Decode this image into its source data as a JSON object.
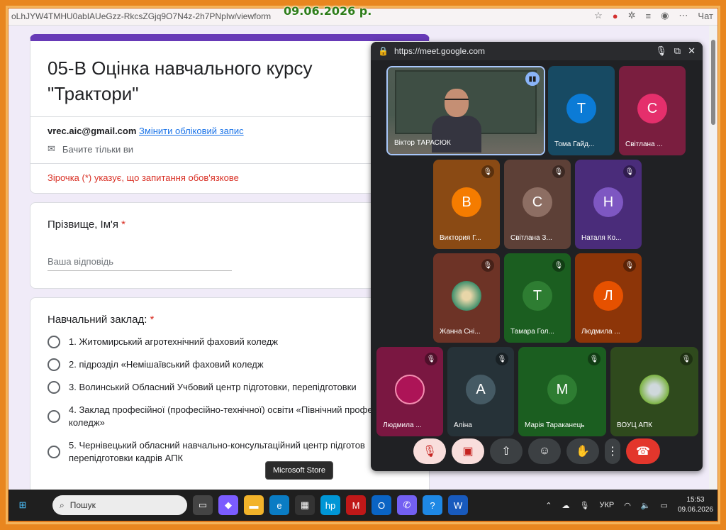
{
  "date_stamp": "09.06.2026 р.",
  "browser": {
    "url": "oLhJYW4TMHU0abIAUeGzz-RkcsZGjq9O7N4z-2h7PNpIw/viewform",
    "chat_label": "Чат"
  },
  "form": {
    "title": "05-В Оцінка навчального курсу \"Трактори\"",
    "account_email": "vrec.aic@gmail.com",
    "switch_account": "Змінити обліковий запис",
    "visibility_note": "Бачите тільки ви",
    "required_note": "Зірочка (*) указує, що запитання обов'язкове",
    "q1": {
      "label": "Прізвище, Ім'я",
      "star": "*",
      "placeholder": "Ваша відповідь"
    },
    "q2": {
      "label": "Навчальний заклад:",
      "star": "*",
      "options": [
        "1. Житомирський агротехнічний фаховий коледж",
        "2. підрозділ «Немішаївський фаховий коледж",
        "3. Волинський Обласний Учбовий центр підготовки, перепідготовки",
        "4. Заклад професійної (професійно-технічної) освіти «Північний профес коледж»",
        "5. Чернівецький обласний навчально-консультаційний центр підготов перепідготовки кадрів АПК"
      ]
    }
  },
  "meet": {
    "url": "https://meet.google.com",
    "participants": [
      {
        "name": "Віктор ТАРАСЮК",
        "initial": "",
        "color": "#4a5a50"
      },
      {
        "name": "Тома Гайд...",
        "initial": "Т",
        "color": "#0b7bd6"
      },
      {
        "name": "Світлана ...",
        "initial": "С",
        "color": "#e52f6c"
      },
      {
        "name": "Виктория Г...",
        "initial": "В",
        "color": "#f57c00"
      },
      {
        "name": "Світлана З...",
        "initial": "С",
        "color": "#8d6e63"
      },
      {
        "name": "Наталя Ко...",
        "initial": "Н",
        "color": "#7e57c2"
      },
      {
        "name": "Жанна Сні...",
        "initial": "",
        "color": "#8f4c3a"
      },
      {
        "name": "Тамара Гол...",
        "initial": "Т",
        "color": "#2e7d32"
      },
      {
        "name": "Людмила ...",
        "initial": "Л",
        "color": "#e65100"
      },
      {
        "name": "Людмила ...",
        "initial": "",
        "color": "#ad1457"
      },
      {
        "name": "Аліна",
        "initial": "А",
        "color": "#455a64"
      },
      {
        "name": "Марія Тараканець",
        "initial": "М",
        "color": "#2e7d32"
      },
      {
        "name": "ВОУЦ АПК",
        "initial": "",
        "color": "#33691e"
      }
    ]
  },
  "tooltip": "Microsoft Store",
  "taskbar": {
    "search_placeholder": "Пошук",
    "lang": "УКР",
    "time": "15:53",
    "date": "09.06.2026"
  }
}
